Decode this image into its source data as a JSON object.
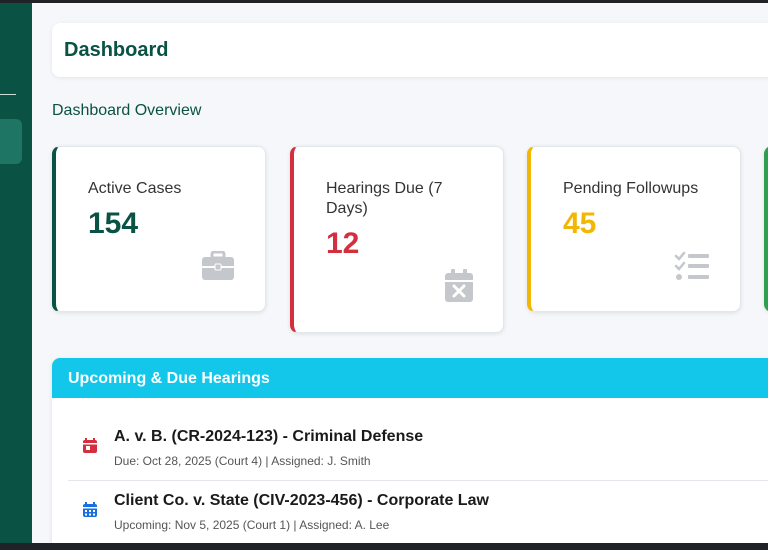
{
  "header": {
    "title": "Dashboard"
  },
  "overview": {
    "title": "Dashboard Overview"
  },
  "cards": [
    {
      "label": "Active Cases",
      "value": "154",
      "icon": "briefcase-icon",
      "color": "#0a5244"
    },
    {
      "label": "Hearings Due (7 Days)",
      "value": "12",
      "icon": "calendar-x-icon",
      "color": "#d32f3f"
    },
    {
      "label": "Pending Followups",
      "value": "45",
      "icon": "checklist-icon",
      "color": "#f2b705"
    }
  ],
  "hearings": {
    "title": "Upcoming & Due Hearings",
    "items": [
      {
        "title": "A. v. B. (CR-2024-123) - Criminal Defense",
        "subtitle": "Due: Oct 28, 2025 (Court 4) | Assigned: J. Smith",
        "icon": "calendar-icon",
        "color": "#d32f3f"
      },
      {
        "title": "Client Co. v. State (CIV-2023-456) - Corporate Law",
        "subtitle": "Upcoming: Nov 5, 2025 (Court 1) | Assigned: A. Lee",
        "icon": "calendar-grid-icon",
        "color": "#1a6fe0"
      }
    ]
  },
  "colors": {
    "sidebar": "#0a5244",
    "accent_cyan": "#12c7ea",
    "card4_border": "#2e9e4f"
  }
}
